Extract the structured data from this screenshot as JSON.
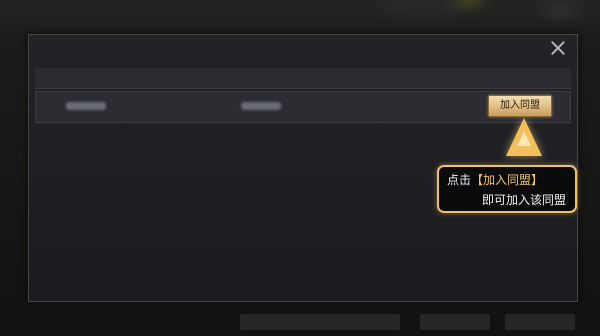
{
  "dialog": {
    "title": "",
    "close_icon": "close-icon"
  },
  "table": {
    "columns": [
      "",
      "",
      "",
      "",
      "",
      ""
    ],
    "row": {
      "guild_name": "",
      "level": "",
      "leader": "",
      "status": "",
      "requirement": ""
    }
  },
  "join_button_label": "加入同盟",
  "tooltip": {
    "prefix": "点击",
    "highlight": "【加入同盟】",
    "line2": "即可加入该同盟"
  },
  "colors": {
    "accent": "#f0c35e",
    "button_top": "#f3ddb0",
    "button_bottom": "#c99c5e",
    "panel": "#1c1c20"
  }
}
